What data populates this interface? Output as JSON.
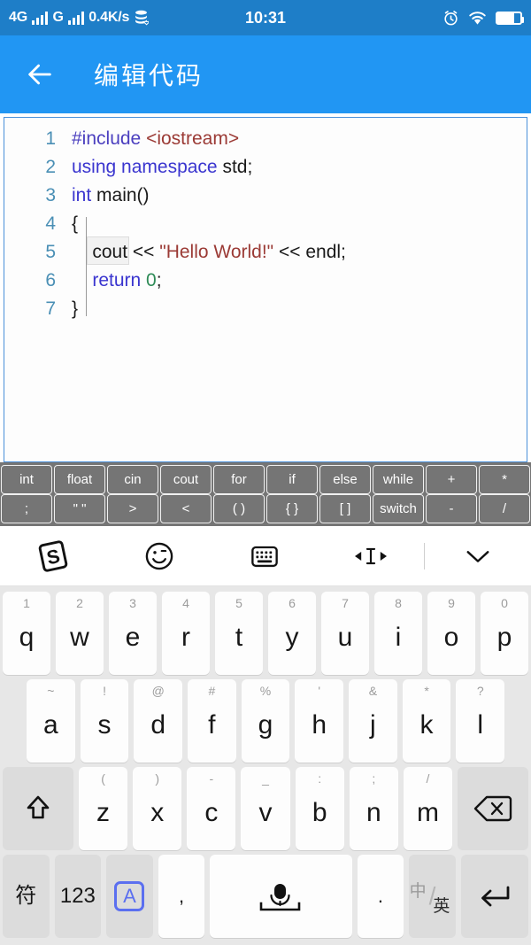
{
  "status_bar": {
    "network_type": "4G",
    "network_type_2": "G",
    "data_speed": "0.4K/s",
    "time": "10:31",
    "icons": [
      "signal-bars-icon",
      "signal-bars-icon",
      "data-transfer-icon",
      "alarm-clock-icon",
      "wifi-icon",
      "battery-icon"
    ],
    "background_color": "#1e7ec8"
  },
  "app_bar": {
    "title": "编辑代码",
    "back_icon": "back-arrow-icon",
    "background_color": "#2196f3"
  },
  "editor": {
    "border_color": "#4a90d9",
    "background_color": "#fdfdfd",
    "lines": [
      {
        "n": "1",
        "tokens": [
          {
            "t": "#include ",
            "c": "tk-pre"
          },
          {
            "t": "<iostream>",
            "c": "tk-inc"
          }
        ]
      },
      {
        "n": "2",
        "tokens": [
          {
            "t": "using namespace ",
            "c": "tk-kw"
          },
          {
            "t": "std;",
            "c": "tk-pl"
          }
        ]
      },
      {
        "n": "3",
        "tokens": [
          {
            "t": "int ",
            "c": "tk-kw"
          },
          {
            "t": "main()",
            "c": "tk-pl"
          }
        ]
      },
      {
        "n": "4",
        "tokens": [
          {
            "t": "{",
            "c": "tk-pl"
          }
        ]
      },
      {
        "n": "5",
        "tokens": [
          {
            "t": "    cout << ",
            "c": "tk-pl"
          },
          {
            "t": "\"Hello World!\"",
            "c": "tk-str"
          },
          {
            "t": " << endl;",
            "c": "tk-pl"
          }
        ]
      },
      {
        "n": "6",
        "tokens": [
          {
            "t": "    ",
            "c": "tk-pl"
          },
          {
            "t": "return ",
            "c": "tk-kw"
          },
          {
            "t": "0",
            "c": "tk-num"
          },
          {
            "t": ";",
            "c": "tk-pl"
          }
        ]
      },
      {
        "n": "7",
        "tokens": [
          {
            "t": "}",
            "c": "tk-pl"
          }
        ]
      }
    ],
    "syntax_colors": {
      "preprocessor": "#4b3fbf",
      "include_path": "#9b3a35",
      "keyword": "#3a35cf",
      "plain": "#1a1a1a",
      "string": "#9b3a35",
      "number": "#2e8b57",
      "line_number": "#4a8fb5"
    }
  },
  "code_toolbar": {
    "background_color": "#757575",
    "row1": [
      "int",
      "float",
      "cin",
      "cout",
      "for",
      "if",
      "else",
      "while",
      "+",
      "*"
    ],
    "row2": [
      ";",
      "\" \"",
      ">",
      "<",
      "( )",
      "{ }",
      "[ ]",
      "switch",
      "-",
      "/"
    ]
  },
  "ime_bar": {
    "items": [
      {
        "name": "sogou-logo-icon",
        "label": "S"
      },
      {
        "name": "emoji-icon",
        "label": ""
      },
      {
        "name": "keyboard-icon",
        "label": ""
      },
      {
        "name": "cursor-move-icon",
        "label": ""
      },
      {
        "name": "chevron-down-icon",
        "label": ""
      }
    ]
  },
  "keyboard": {
    "background_color": "#e7e7e7",
    "row1": [
      {
        "main": "q",
        "sup": "1"
      },
      {
        "main": "w",
        "sup": "2"
      },
      {
        "main": "e",
        "sup": "3"
      },
      {
        "main": "r",
        "sup": "4"
      },
      {
        "main": "t",
        "sup": "5"
      },
      {
        "main": "y",
        "sup": "6"
      },
      {
        "main": "u",
        "sup": "7"
      },
      {
        "main": "i",
        "sup": "8"
      },
      {
        "main": "o",
        "sup": "9"
      },
      {
        "main": "p",
        "sup": "0"
      }
    ],
    "row2": [
      {
        "main": "a",
        "sup": "~"
      },
      {
        "main": "s",
        "sup": "!"
      },
      {
        "main": "d",
        "sup": "@"
      },
      {
        "main": "f",
        "sup": "#"
      },
      {
        "main": "g",
        "sup": "%"
      },
      {
        "main": "h",
        "sup": "'"
      },
      {
        "main": "j",
        "sup": "&"
      },
      {
        "main": "k",
        "sup": "*"
      },
      {
        "main": "l",
        "sup": "?"
      }
    ],
    "row3": [
      {
        "main": "z",
        "sup": "("
      },
      {
        "main": "x",
        "sup": ")"
      },
      {
        "main": "c",
        "sup": "-"
      },
      {
        "main": "v",
        "sup": "_"
      },
      {
        "main": "b",
        "sup": ":"
      },
      {
        "main": "n",
        "sup": ";"
      },
      {
        "main": "m",
        "sup": "/"
      }
    ],
    "shift_key": {
      "name": "shift-icon",
      "label": ""
    },
    "backspace_key": {
      "name": "backspace-icon",
      "label": ""
    },
    "row4": {
      "symbols_key": "符",
      "numbers_key": "123",
      "caps_key": "A",
      "comma_key": ",",
      "space_key": "space-bar-with-mic-icon",
      "period_key": ".",
      "lang_cn": "中",
      "lang_en": "英",
      "enter_key": "enter-icon"
    },
    "accent_color": "#5b6ff0"
  }
}
